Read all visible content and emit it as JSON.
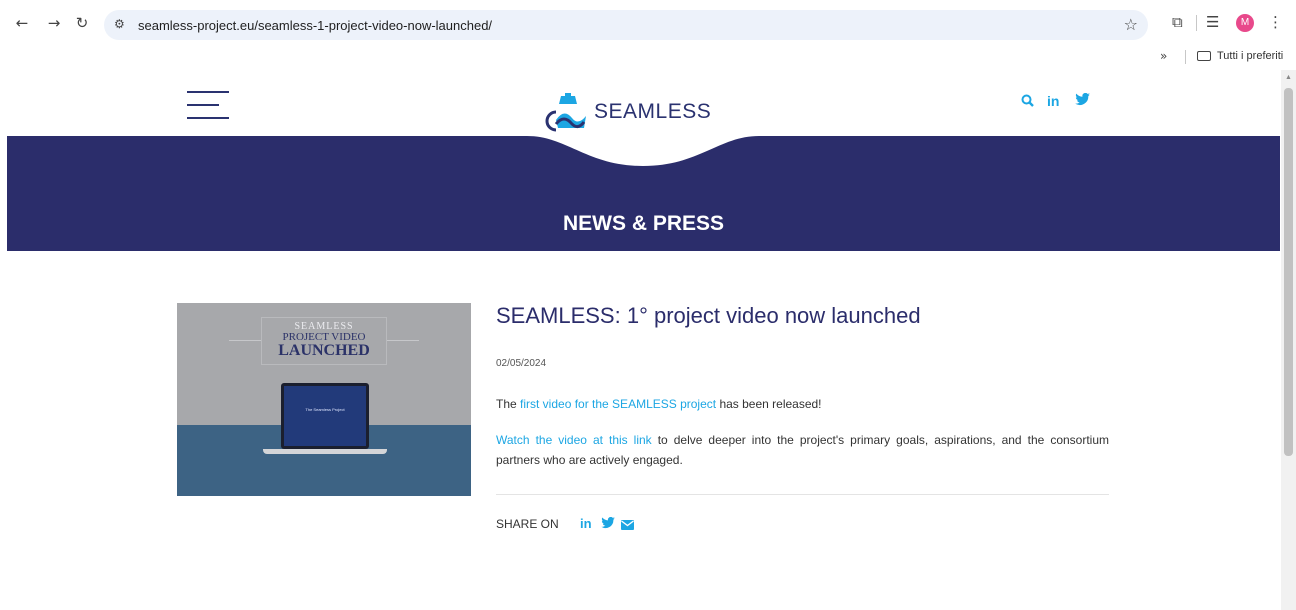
{
  "browser": {
    "url": "seamless-project.eu/seamless-1-project-video-now-launched/",
    "profile_initial": "M",
    "bookmarks_more": "»",
    "bookmarks_folder_label": "Tutti i preferiti"
  },
  "site": {
    "logo_text": "SEAMLESS",
    "header_icons": [
      "search-icon",
      "linkedin-icon",
      "twitter-icon"
    ],
    "section_title": "NEWS & PRESS",
    "brand_color": "#2b2d6b",
    "accent_color": "#1ca6e3"
  },
  "article": {
    "title": "SEAMLESS: 1° project video now launched",
    "date": "02/05/2024",
    "p1_before": "The ",
    "p1_link": "first video for the SEAMLESS project",
    "p1_after": " has been released!",
    "p2_link": "Watch the video at this link",
    "p2_after": " to delve deeper into the project's primary goals, aspirations, and the consortium partners who are actively engaged.",
    "share_label": "SHARE ON",
    "share_icons": [
      "linkedin-icon",
      "twitter-icon",
      "email-icon"
    ],
    "thumbnail": {
      "line1": "SEAMLESS",
      "line2": "PROJECT VIDEO",
      "line3": "LAUNCHED",
      "screen_caption": "The Seamless Project"
    }
  }
}
